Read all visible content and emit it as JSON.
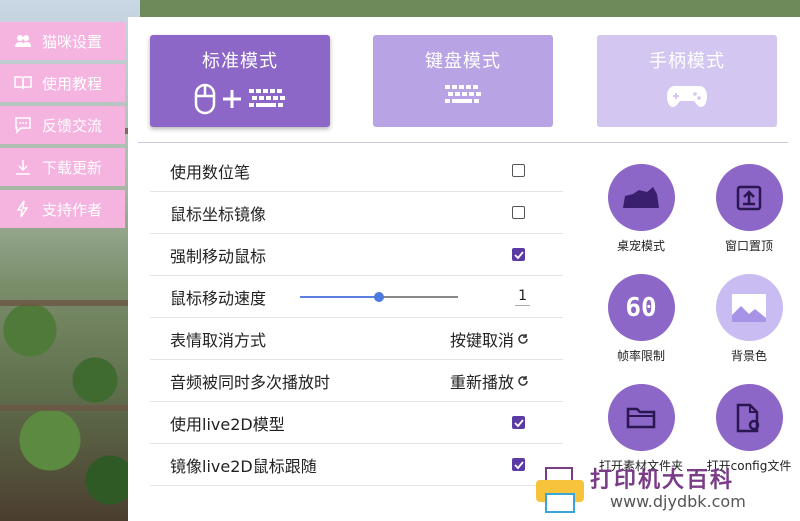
{
  "sidebar": {
    "items": [
      {
        "label": "猫咪设置",
        "icon": "users-icon"
      },
      {
        "label": "使用教程",
        "icon": "book-icon"
      },
      {
        "label": "反馈交流",
        "icon": "chat-icon"
      },
      {
        "label": "下载更新",
        "icon": "download-icon"
      },
      {
        "label": "支持作者",
        "icon": "bolt-icon"
      }
    ]
  },
  "modes": [
    {
      "label": "标准模式",
      "icons": [
        "mouse-icon",
        "plus-icon",
        "keyboard-icon"
      ],
      "selected": true
    },
    {
      "label": "键盘模式",
      "icons": [
        "keyboard-icon"
      ],
      "selected": false
    },
    {
      "label": "手柄模式",
      "icons": [
        "gamepad-icon"
      ],
      "selected": false
    }
  ],
  "settings": {
    "use_pen": {
      "label": "使用数位笔",
      "checked": false
    },
    "mirror_mouse": {
      "label": "鼠标坐标镜像",
      "checked": false
    },
    "force_move": {
      "label": "强制移动鼠标",
      "checked": true
    },
    "move_speed": {
      "label": "鼠标移动速度",
      "value": "1",
      "fraction": 0.5
    },
    "emote_cancel": {
      "label": "表情取消方式",
      "value": "按键取消"
    },
    "audio_overlap": {
      "label": "音频被同时多次播放时",
      "value": "重新播放"
    },
    "use_live2d": {
      "label": "使用live2D模型",
      "checked": true
    },
    "mirror_live2d": {
      "label": "镜像live2D鼠标跟随",
      "checked": true
    }
  },
  "tools": [
    {
      "label": "桌宠模式",
      "icon": "cat-icon",
      "style": "dark"
    },
    {
      "label": "窗口置顶",
      "icon": "pin-top-icon",
      "style": "dark"
    },
    {
      "label": "帧率限制",
      "icon": "fps-60-icon",
      "style": "dark"
    },
    {
      "label": "背景色",
      "icon": "image-icon",
      "style": "light"
    },
    {
      "label": "打开素材文件夹",
      "icon": "folder-icon",
      "style": "dark"
    },
    {
      "label": "打开config文件",
      "icon": "file-gear-icon",
      "style": "dark"
    }
  ],
  "fps_text": "60",
  "watermark": {
    "line1": "打印机大百科",
    "line2": "www.djydbk.com"
  },
  "colors": {
    "accent": "#8c67c7",
    "sidebar": "#f4b4df",
    "checkbox": "#5b3aa6",
    "slider": "#4d7ae0"
  }
}
